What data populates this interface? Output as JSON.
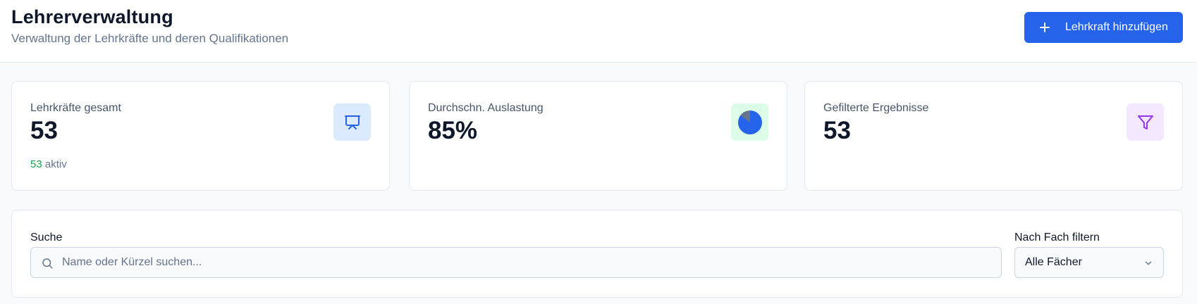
{
  "header": {
    "title": "Lehrerverwaltung",
    "subtitle": "Verwaltung der Lehrkräfte und deren Qualifikationen",
    "add_button_label": "Lehrkraft hinzufügen"
  },
  "stats": [
    {
      "label": "Lehrkräfte gesamt",
      "value": "53",
      "foot_count": "53",
      "foot_text": " aktiv",
      "icon": "presentation-icon",
      "color": "#2563eb"
    },
    {
      "label": "Durchschn. Auslastung",
      "value": "85%",
      "icon": "pie-chart-icon",
      "level": 0.85,
      "color": "#2563eb"
    },
    {
      "label": "Gefilterte Ergebnisse",
      "value": "53",
      "icon": "filter-icon",
      "color": "#9333ea"
    }
  ],
  "filters": {
    "search_label": "Suche",
    "search_placeholder": "Name oder Kürzel suchen...",
    "search_value": "",
    "subject_label": "Nach Fach filtern",
    "subject_selected": "Alle Fächer"
  },
  "colors": {
    "accent": "#2563eb",
    "success": "#16a34a",
    "purple": "#9333ea"
  }
}
